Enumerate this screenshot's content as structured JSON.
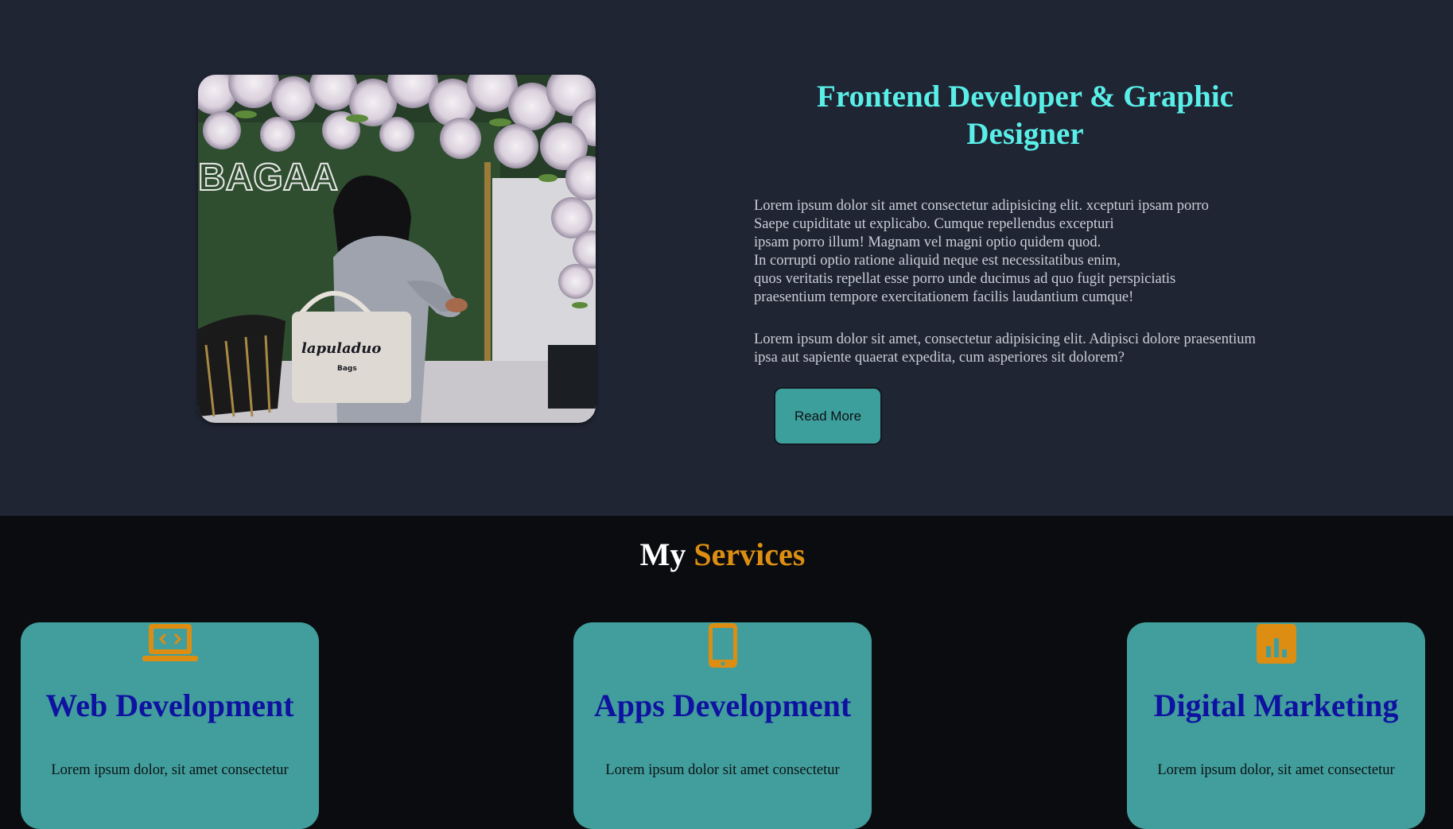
{
  "about": {
    "title": "Frontend Developer & Graphic Designer",
    "photo": {
      "sign_text": "BAGAA",
      "bag_text_1": "lapuladuo",
      "bag_text_2": "Bags"
    },
    "paragraph_1": "Lorem ipsum dolor sit amet consectetur adipisicing elit. xcepturi ipsam porro\nSaepe cupiditate ut explicabo. Cumque repellendus excepturi\nipsam porro illum! Magnam vel magni optio quidem quod.\nIn corrupti optio ratione aliquid neque est necessitatibus enim,\nquos veritatis repellat esse porro unde ducimus ad quo fugit perspiciatis\npraesentium tempore exercitationem facilis laudantium cumque!",
    "paragraph_2": "Lorem ipsum dolor sit amet, consectetur adipisicing elit. Adipisci dolore praesentium\nipsa aut sapiente quaerat expedita, cum asperiores sit dolorem?",
    "button_label": "Read More"
  },
  "services": {
    "title_white": "My",
    "title_accent": "Services",
    "cards": [
      {
        "icon": "laptop-code-icon",
        "title": "Web Development",
        "text": "Lorem ipsum dolor, sit amet consectetur"
      },
      {
        "icon": "mobile-phone-icon",
        "title": "Apps Development",
        "text": "Lorem ipsum dolor sit amet consectetur"
      },
      {
        "icon": "chart-bar-icon",
        "title": "Digital Marketing",
        "text": "Lorem ipsum dolor, sit amet consectetur"
      }
    ]
  },
  "colors": {
    "about_bg": "#1f2533",
    "services_bg": "#0a0c10",
    "accent_cyan": "#59eee8",
    "accent_orange": "#dd8e12",
    "card_teal": "#419e9c",
    "card_title_blue": "#0f12a0",
    "button_teal": "#3d9f9c"
  }
}
